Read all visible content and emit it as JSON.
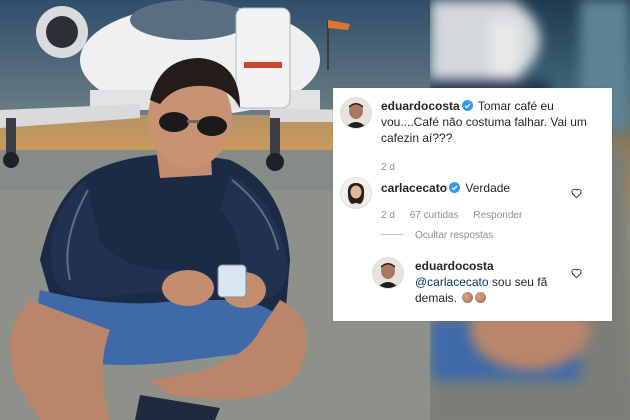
{
  "comments": [
    {
      "username": "eduardocosta",
      "verified": true,
      "text": "Tomar café eu vou....Café não costuma falhar. Vai um cafezin aí???",
      "time": "2 d"
    },
    {
      "username": "carlacecato",
      "verified": true,
      "text": "Verdade",
      "time": "2 d",
      "likes": "67 curtidas",
      "reply_label": "Responder",
      "hide_replies_label": "Ocultar respostas"
    }
  ],
  "reply": {
    "username": "eduardocosta",
    "mention": "@carlacecato",
    "text": "sou seu fã demais."
  },
  "icons": {
    "verified": "verified-badge-icon",
    "like": "heart-outline-icon",
    "emoji": "clapping-hands-emoji"
  },
  "colors": {
    "verified_blue": "#3897f0",
    "meta_gray": "#8e8e8e",
    "mention_blue": "#00376b"
  }
}
